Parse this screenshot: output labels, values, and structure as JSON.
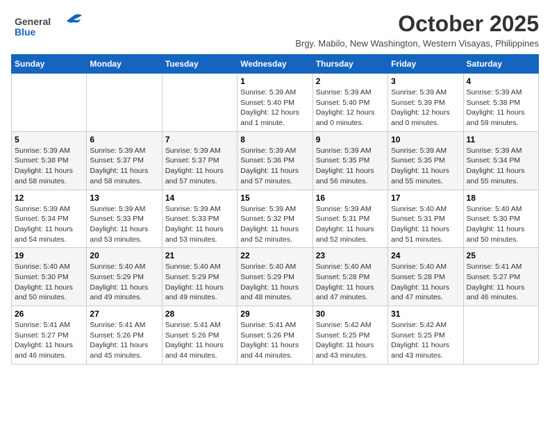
{
  "logo": {
    "general": "General",
    "blue": "Blue"
  },
  "title": "October 2025",
  "subtitle": "Brgy. Mabilo, New Washington, Western Visayas, Philippines",
  "days_of_week": [
    "Sunday",
    "Monday",
    "Tuesday",
    "Wednesday",
    "Thursday",
    "Friday",
    "Saturday"
  ],
  "weeks": [
    [
      {
        "day": "",
        "sunrise": "",
        "sunset": "",
        "daylight": ""
      },
      {
        "day": "",
        "sunrise": "",
        "sunset": "",
        "daylight": ""
      },
      {
        "day": "",
        "sunrise": "",
        "sunset": "",
        "daylight": ""
      },
      {
        "day": "1",
        "sunrise": "Sunrise: 5:39 AM",
        "sunset": "Sunset: 5:40 PM",
        "daylight": "Daylight: 12 hours and 1 minute."
      },
      {
        "day": "2",
        "sunrise": "Sunrise: 5:39 AM",
        "sunset": "Sunset: 5:40 PM",
        "daylight": "Daylight: 12 hours and 0 minutes."
      },
      {
        "day": "3",
        "sunrise": "Sunrise: 5:39 AM",
        "sunset": "Sunset: 5:39 PM",
        "daylight": "Daylight: 12 hours and 0 minutes."
      },
      {
        "day": "4",
        "sunrise": "Sunrise: 5:39 AM",
        "sunset": "Sunset: 5:38 PM",
        "daylight": "Daylight: 11 hours and 59 minutes."
      }
    ],
    [
      {
        "day": "5",
        "sunrise": "Sunrise: 5:39 AM",
        "sunset": "Sunset: 5:38 PM",
        "daylight": "Daylight: 11 hours and 58 minutes."
      },
      {
        "day": "6",
        "sunrise": "Sunrise: 5:39 AM",
        "sunset": "Sunset: 5:37 PM",
        "daylight": "Daylight: 11 hours and 58 minutes."
      },
      {
        "day": "7",
        "sunrise": "Sunrise: 5:39 AM",
        "sunset": "Sunset: 5:37 PM",
        "daylight": "Daylight: 11 hours and 57 minutes."
      },
      {
        "day": "8",
        "sunrise": "Sunrise: 5:39 AM",
        "sunset": "Sunset: 5:36 PM",
        "daylight": "Daylight: 11 hours and 57 minutes."
      },
      {
        "day": "9",
        "sunrise": "Sunrise: 5:39 AM",
        "sunset": "Sunset: 5:35 PM",
        "daylight": "Daylight: 11 hours and 56 minutes."
      },
      {
        "day": "10",
        "sunrise": "Sunrise: 5:39 AM",
        "sunset": "Sunset: 5:35 PM",
        "daylight": "Daylight: 11 hours and 55 minutes."
      },
      {
        "day": "11",
        "sunrise": "Sunrise: 5:39 AM",
        "sunset": "Sunset: 5:34 PM",
        "daylight": "Daylight: 11 hours and 55 minutes."
      }
    ],
    [
      {
        "day": "12",
        "sunrise": "Sunrise: 5:39 AM",
        "sunset": "Sunset: 5:34 PM",
        "daylight": "Daylight: 11 hours and 54 minutes."
      },
      {
        "day": "13",
        "sunrise": "Sunrise: 5:39 AM",
        "sunset": "Sunset: 5:33 PM",
        "daylight": "Daylight: 11 hours and 53 minutes."
      },
      {
        "day": "14",
        "sunrise": "Sunrise: 5:39 AM",
        "sunset": "Sunset: 5:33 PM",
        "daylight": "Daylight: 11 hours and 53 minutes."
      },
      {
        "day": "15",
        "sunrise": "Sunrise: 5:39 AM",
        "sunset": "Sunset: 5:32 PM",
        "daylight": "Daylight: 11 hours and 52 minutes."
      },
      {
        "day": "16",
        "sunrise": "Sunrise: 5:39 AM",
        "sunset": "Sunset: 5:31 PM",
        "daylight": "Daylight: 11 hours and 52 minutes."
      },
      {
        "day": "17",
        "sunrise": "Sunrise: 5:40 AM",
        "sunset": "Sunset: 5:31 PM",
        "daylight": "Daylight: 11 hours and 51 minutes."
      },
      {
        "day": "18",
        "sunrise": "Sunrise: 5:40 AM",
        "sunset": "Sunset: 5:30 PM",
        "daylight": "Daylight: 11 hours and 50 minutes."
      }
    ],
    [
      {
        "day": "19",
        "sunrise": "Sunrise: 5:40 AM",
        "sunset": "Sunset: 5:30 PM",
        "daylight": "Daylight: 11 hours and 50 minutes."
      },
      {
        "day": "20",
        "sunrise": "Sunrise: 5:40 AM",
        "sunset": "Sunset: 5:29 PM",
        "daylight": "Daylight: 11 hours and 49 minutes."
      },
      {
        "day": "21",
        "sunrise": "Sunrise: 5:40 AM",
        "sunset": "Sunset: 5:29 PM",
        "daylight": "Daylight: 11 hours and 49 minutes."
      },
      {
        "day": "22",
        "sunrise": "Sunrise: 5:40 AM",
        "sunset": "Sunset: 5:29 PM",
        "daylight": "Daylight: 11 hours and 48 minutes."
      },
      {
        "day": "23",
        "sunrise": "Sunrise: 5:40 AM",
        "sunset": "Sunset: 5:28 PM",
        "daylight": "Daylight: 11 hours and 47 minutes."
      },
      {
        "day": "24",
        "sunrise": "Sunrise: 5:40 AM",
        "sunset": "Sunset: 5:28 PM",
        "daylight": "Daylight: 11 hours and 47 minutes."
      },
      {
        "day": "25",
        "sunrise": "Sunrise: 5:41 AM",
        "sunset": "Sunset: 5:27 PM",
        "daylight": "Daylight: 11 hours and 46 minutes."
      }
    ],
    [
      {
        "day": "26",
        "sunrise": "Sunrise: 5:41 AM",
        "sunset": "Sunset: 5:27 PM",
        "daylight": "Daylight: 11 hours and 46 minutes."
      },
      {
        "day": "27",
        "sunrise": "Sunrise: 5:41 AM",
        "sunset": "Sunset: 5:26 PM",
        "daylight": "Daylight: 11 hours and 45 minutes."
      },
      {
        "day": "28",
        "sunrise": "Sunrise: 5:41 AM",
        "sunset": "Sunset: 5:26 PM",
        "daylight": "Daylight: 11 hours and 44 minutes."
      },
      {
        "day": "29",
        "sunrise": "Sunrise: 5:41 AM",
        "sunset": "Sunset: 5:26 PM",
        "daylight": "Daylight: 11 hours and 44 minutes."
      },
      {
        "day": "30",
        "sunrise": "Sunrise: 5:42 AM",
        "sunset": "Sunset: 5:25 PM",
        "daylight": "Daylight: 11 hours and 43 minutes."
      },
      {
        "day": "31",
        "sunrise": "Sunrise: 5:42 AM",
        "sunset": "Sunset: 5:25 PM",
        "daylight": "Daylight: 11 hours and 43 minutes."
      },
      {
        "day": "",
        "sunrise": "",
        "sunset": "",
        "daylight": ""
      }
    ]
  ]
}
